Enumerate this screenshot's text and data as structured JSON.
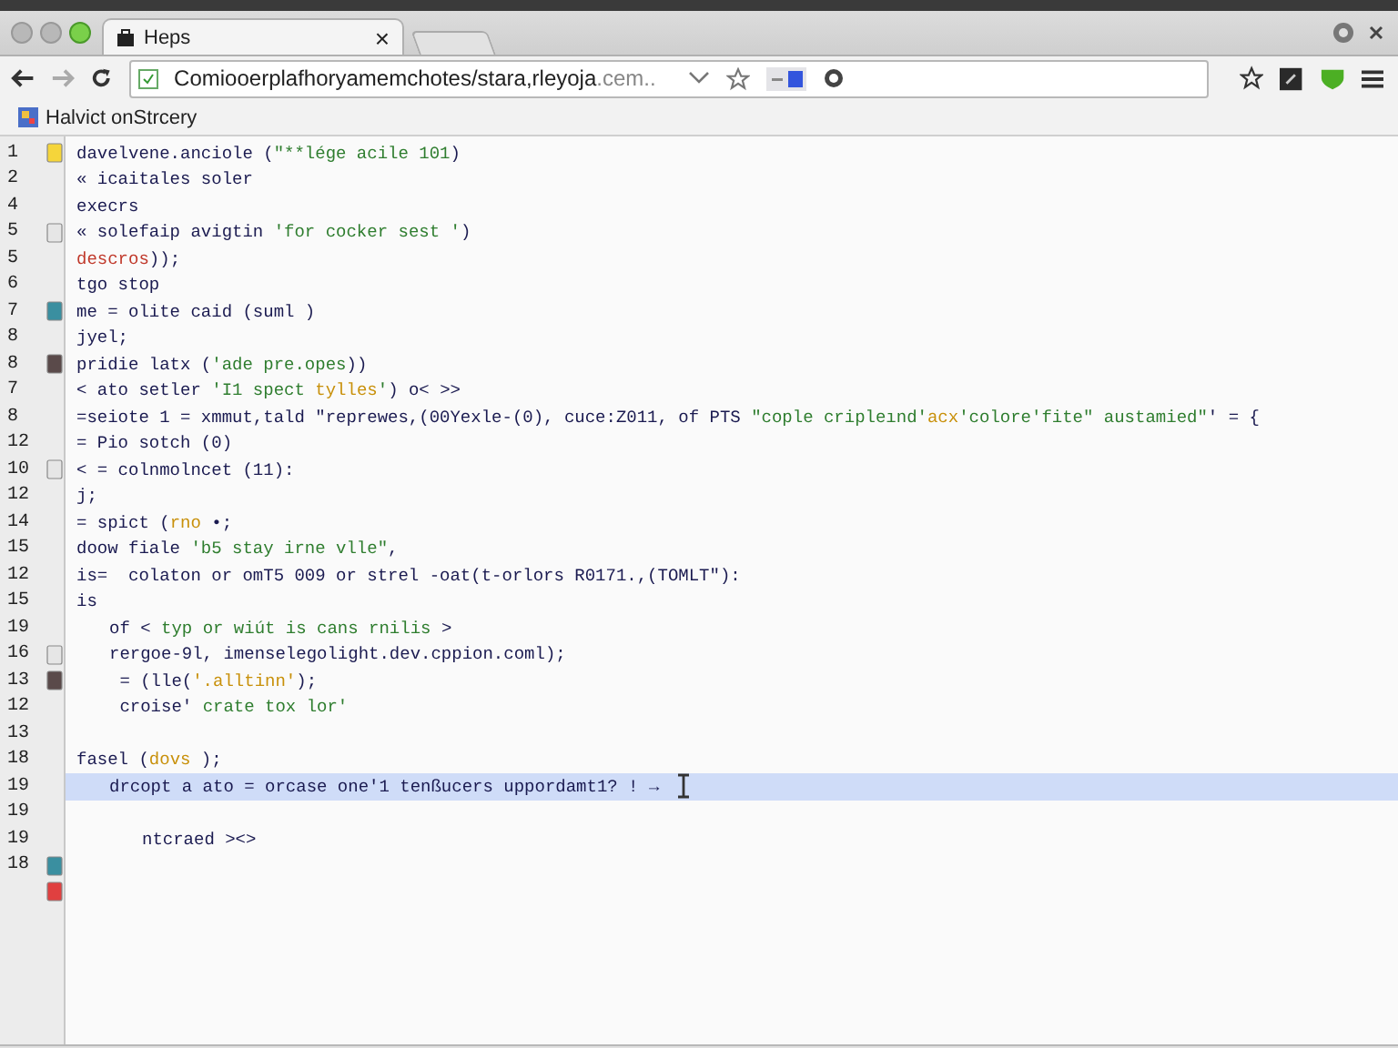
{
  "window": {
    "tab": {
      "title": "Heps",
      "close": "×"
    }
  },
  "toolbar": {
    "url": "Comiooerplafhoryamemchotes/stara,rleyoja",
    "url_suffix": ".cem.."
  },
  "bookmarks": [
    {
      "label": "Halvict onStrcery"
    }
  ],
  "editor": {
    "lines": [
      {
        "number": "1",
        "mark": {
          "color": "#f5d53a"
        },
        "kind": "flush",
        "segments": [
          {
            "text": "davelvene.anciole (",
            "kind": "plain"
          },
          {
            "text": "\"**lége acile 101",
            "kind": "string"
          },
          {
            "text": ")",
            "kind": "plain"
          }
        ]
      },
      {
        "number": "2",
        "kind": "flush",
        "segments": [
          {
            "text": "« icaitales soler",
            "kind": "plain"
          }
        ]
      },
      {
        "number": "4",
        "kind": "flush",
        "segments": [
          {
            "text": "execrs",
            "kind": "plain"
          }
        ]
      },
      {
        "number": "5",
        "mark": {
          "color": "#e6e6e6"
        },
        "kind": "flush",
        "segments": [
          {
            "text": "« solefaip avigtin ",
            "kind": "plain"
          },
          {
            "text": "'for cocker sest '",
            "kind": "string"
          },
          {
            "text": ")",
            "kind": "plain"
          }
        ]
      },
      {
        "number": "5",
        "kind": "flush",
        "segments": [
          {
            "text": "descros",
            "kind": "error"
          },
          {
            "text": "));",
            "kind": "plain"
          }
        ]
      },
      {
        "number": "6",
        "kind": "flush",
        "segments": [
          {
            "text": "tgo stop",
            "kind": "plain"
          }
        ]
      },
      {
        "number": "7",
        "mark": {
          "color": "#3a8fa0"
        },
        "kind": "flush",
        "segments": [
          {
            "text": "me = olite caid (suml )",
            "kind": "plain"
          }
        ]
      },
      {
        "number": "8",
        "kind": "flush",
        "segments": [
          {
            "text": "jyel;",
            "kind": "plain"
          }
        ]
      },
      {
        "number": "8",
        "mark": {
          "color": "#5a4a4a"
        },
        "kind": "flush",
        "segments": [
          {
            "text": "pridie latx (",
            "kind": "plain"
          },
          {
            "text": "'ade pre.opes",
            "kind": "string"
          },
          {
            "text": "))",
            "kind": "plain"
          }
        ]
      },
      {
        "number": "7",
        "kind": "flush",
        "segments": [
          {
            "text": "< ato setler ",
            "kind": "plain"
          },
          {
            "text": "'I1 spect ",
            "kind": "string"
          },
          {
            "text": "tylles",
            "kind": "keyword"
          },
          {
            "text": "'",
            "kind": "string"
          },
          {
            "text": ") o< >>",
            "kind": "plain"
          }
        ]
      },
      {
        "number": "8",
        "kind": "flush",
        "segments": [
          {
            "text": "=seiote 1 = xmmut,tald \"reprewes,(00Yexle-(0), cuce:Z011, of PTS ",
            "kind": "plain"
          },
          {
            "text": "\"cople cripleınd'",
            "kind": "string"
          },
          {
            "text": "acx",
            "kind": "keyword"
          },
          {
            "text": "'colore'fite\" austamied\"",
            "kind": "string"
          },
          {
            "text": "' = {",
            "kind": "plain"
          }
        ]
      },
      {
        "number": "12",
        "kind": "flush",
        "segments": [
          {
            "text": "= Pio sotch (0)",
            "kind": "plain"
          }
        ]
      },
      {
        "number": "10",
        "mark": {
          "color": "#e6e6e6"
        },
        "kind": "flush",
        "segments": [
          {
            "text": "< = colnmolncet (11):",
            "kind": "plain"
          }
        ]
      },
      {
        "number": "12",
        "kind": "flush",
        "segments": [
          {
            "text": "j;",
            "kind": "plain"
          }
        ]
      },
      {
        "number": "14",
        "kind": "flush",
        "segments": [
          {
            "text": "= spict (",
            "kind": "plain"
          },
          {
            "text": "rno",
            "kind": "keyword"
          },
          {
            "text": " •;",
            "kind": "plain"
          }
        ]
      },
      {
        "number": "15",
        "kind": "flush",
        "segments": [
          {
            "text": "doow fiale ",
            "kind": "plain"
          },
          {
            "text": "'b5 stay irne vlle\"",
            "kind": "string"
          },
          {
            "text": ",",
            "kind": "plain"
          }
        ]
      },
      {
        "number": "12",
        "kind": "flush",
        "segments": [
          {
            "text": "is=  colaton or omT5 009 or strel -oat(t-orlors R0171.,(TOMLT\"):",
            "kind": "plain"
          }
        ]
      },
      {
        "number": "15",
        "kind": "flush",
        "segments": [
          {
            "text": "is",
            "kind": "plain"
          }
        ]
      },
      {
        "number": "19",
        "kind": "indented",
        "segments": [
          {
            "text": "of < ",
            "kind": "plain"
          },
          {
            "text": "typ or wiút is cans rnilis",
            "kind": "string"
          },
          {
            "text": " >",
            "kind": "plain"
          }
        ]
      },
      {
        "number": "16",
        "mark": {
          "color": "#e6e6e6"
        },
        "kind": "indented",
        "segments": [
          {
            "text": "rergoe-9l, imenselegolight.dev.cppion.coml);",
            "kind": "plain"
          }
        ]
      },
      {
        "number": "13",
        "mark": {
          "color": "#5a4a4a"
        },
        "kind": "indented",
        "segments": [
          {
            "text": " = (lle(",
            "kind": "plain"
          },
          {
            "text": "'.alltinn'",
            "kind": "keyword"
          },
          {
            "text": ");",
            "kind": "plain"
          }
        ]
      },
      {
        "number": "12",
        "kind": "indented",
        "segments": [
          {
            "text": " croise' ",
            "kind": "plain"
          },
          {
            "text": "crate tox lor'",
            "kind": "string"
          }
        ]
      },
      {
        "number": "13",
        "kind": "flush"
      },
      {
        "number": "18",
        "kind": "flush",
        "segments": [
          {
            "text": "fasel (",
            "kind": "plain"
          },
          {
            "text": "dovs",
            "kind": "keyword"
          },
          {
            "text": " );",
            "kind": "plain"
          }
        ]
      },
      {
        "number": "19",
        "kind": "indented",
        "selected": true,
        "segments": [
          {
            "text": "drcopt a ato = orcase one'1 tenßucers uppordamt1? ! →",
            "kind": "plain"
          }
        ]
      },
      {
        "number": "19",
        "kind": "flush"
      },
      {
        "number": "19",
        "kind": "deep",
        "segments": [
          {
            "text": "ntcraed ><>",
            "kind": "plain"
          }
        ]
      },
      {
        "number": "18",
        "mark": {
          "color": "#3a8fa0"
        },
        "kind": "flush"
      },
      {
        "mark": {
          "color": "#e04040"
        },
        "kind": "flush"
      }
    ]
  }
}
